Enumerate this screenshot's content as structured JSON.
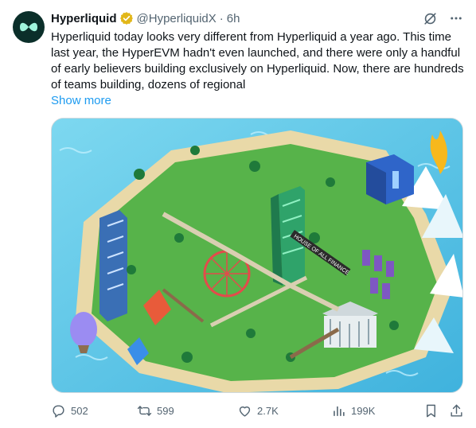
{
  "tweet": {
    "author_name": "Hyperliquid",
    "author_handle": "@HyperliquidX",
    "separator": "·",
    "time": "6h",
    "text": "Hyperliquid today looks very different from Hyperliquid a year ago. This time last year, the HyperEVM hadn't even launched, and there were only a handful of early believers building exclusively on Hyperliquid. Now, there are hundreds of teams building, dozens of regional",
    "show_more": "Show more"
  },
  "icons": {
    "avatar": "hyperliquid-logo",
    "verified": "verified-badge-icon",
    "grok": "grok-icon",
    "more": "more-icon",
    "reply": "reply-icon",
    "repost": "repost-icon",
    "like": "like-icon",
    "views": "views-icon",
    "bookmark": "bookmark-icon",
    "share": "share-icon"
  },
  "media": {
    "description_kind": "isometric pixel-art island city illustration",
    "sign_text": "HOUSE OF ALL FINANCE"
  },
  "stats": {
    "replies": "502",
    "reposts": "599",
    "likes": "2.7K",
    "views": "199K"
  },
  "colors": {
    "link": "#1d9bf0",
    "secondary_text": "#536471",
    "verified_gold": "#e2b719",
    "avatar_bg": "#0b2f2a",
    "avatar_mark": "#9ff5dc"
  }
}
